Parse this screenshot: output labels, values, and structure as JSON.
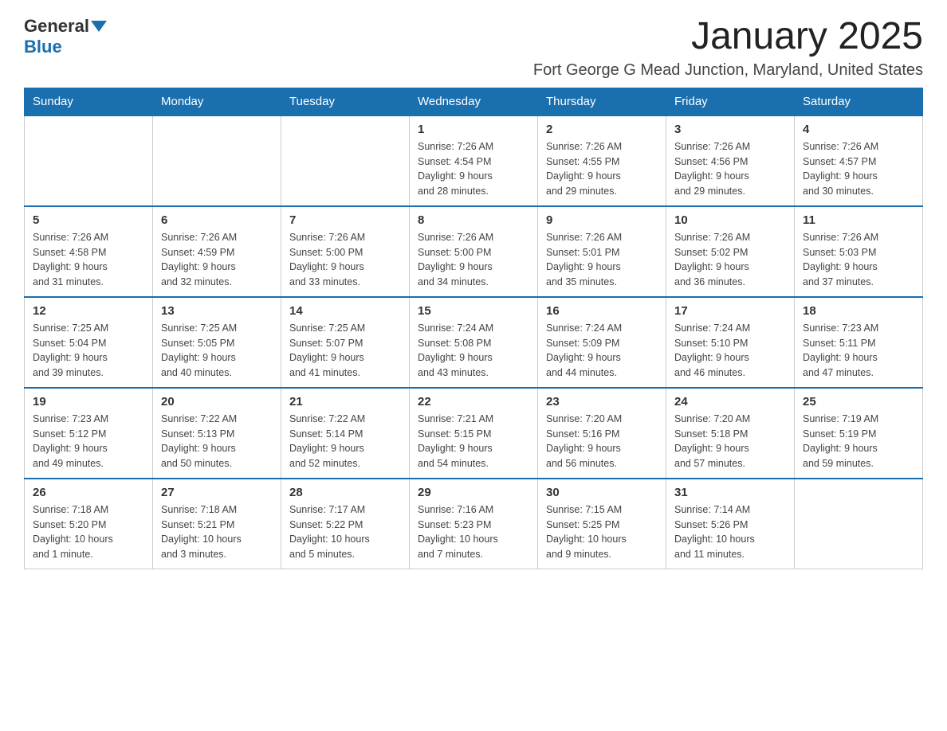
{
  "header": {
    "logo_general": "General",
    "logo_blue": "Blue",
    "month": "January 2025",
    "location": "Fort George G Mead Junction, Maryland, United States"
  },
  "days_of_week": [
    "Sunday",
    "Monday",
    "Tuesday",
    "Wednesday",
    "Thursday",
    "Friday",
    "Saturday"
  ],
  "weeks": [
    {
      "days": [
        {
          "date": "",
          "info": ""
        },
        {
          "date": "",
          "info": ""
        },
        {
          "date": "",
          "info": ""
        },
        {
          "date": "1",
          "info": "Sunrise: 7:26 AM\nSunset: 4:54 PM\nDaylight: 9 hours\nand 28 minutes."
        },
        {
          "date": "2",
          "info": "Sunrise: 7:26 AM\nSunset: 4:55 PM\nDaylight: 9 hours\nand 29 minutes."
        },
        {
          "date": "3",
          "info": "Sunrise: 7:26 AM\nSunset: 4:56 PM\nDaylight: 9 hours\nand 29 minutes."
        },
        {
          "date": "4",
          "info": "Sunrise: 7:26 AM\nSunset: 4:57 PM\nDaylight: 9 hours\nand 30 minutes."
        }
      ]
    },
    {
      "days": [
        {
          "date": "5",
          "info": "Sunrise: 7:26 AM\nSunset: 4:58 PM\nDaylight: 9 hours\nand 31 minutes."
        },
        {
          "date": "6",
          "info": "Sunrise: 7:26 AM\nSunset: 4:59 PM\nDaylight: 9 hours\nand 32 minutes."
        },
        {
          "date": "7",
          "info": "Sunrise: 7:26 AM\nSunset: 5:00 PM\nDaylight: 9 hours\nand 33 minutes."
        },
        {
          "date": "8",
          "info": "Sunrise: 7:26 AM\nSunset: 5:00 PM\nDaylight: 9 hours\nand 34 minutes."
        },
        {
          "date": "9",
          "info": "Sunrise: 7:26 AM\nSunset: 5:01 PM\nDaylight: 9 hours\nand 35 minutes."
        },
        {
          "date": "10",
          "info": "Sunrise: 7:26 AM\nSunset: 5:02 PM\nDaylight: 9 hours\nand 36 minutes."
        },
        {
          "date": "11",
          "info": "Sunrise: 7:26 AM\nSunset: 5:03 PM\nDaylight: 9 hours\nand 37 minutes."
        }
      ]
    },
    {
      "days": [
        {
          "date": "12",
          "info": "Sunrise: 7:25 AM\nSunset: 5:04 PM\nDaylight: 9 hours\nand 39 minutes."
        },
        {
          "date": "13",
          "info": "Sunrise: 7:25 AM\nSunset: 5:05 PM\nDaylight: 9 hours\nand 40 minutes."
        },
        {
          "date": "14",
          "info": "Sunrise: 7:25 AM\nSunset: 5:07 PM\nDaylight: 9 hours\nand 41 minutes."
        },
        {
          "date": "15",
          "info": "Sunrise: 7:24 AM\nSunset: 5:08 PM\nDaylight: 9 hours\nand 43 minutes."
        },
        {
          "date": "16",
          "info": "Sunrise: 7:24 AM\nSunset: 5:09 PM\nDaylight: 9 hours\nand 44 minutes."
        },
        {
          "date": "17",
          "info": "Sunrise: 7:24 AM\nSunset: 5:10 PM\nDaylight: 9 hours\nand 46 minutes."
        },
        {
          "date": "18",
          "info": "Sunrise: 7:23 AM\nSunset: 5:11 PM\nDaylight: 9 hours\nand 47 minutes."
        }
      ]
    },
    {
      "days": [
        {
          "date": "19",
          "info": "Sunrise: 7:23 AM\nSunset: 5:12 PM\nDaylight: 9 hours\nand 49 minutes."
        },
        {
          "date": "20",
          "info": "Sunrise: 7:22 AM\nSunset: 5:13 PM\nDaylight: 9 hours\nand 50 minutes."
        },
        {
          "date": "21",
          "info": "Sunrise: 7:22 AM\nSunset: 5:14 PM\nDaylight: 9 hours\nand 52 minutes."
        },
        {
          "date": "22",
          "info": "Sunrise: 7:21 AM\nSunset: 5:15 PM\nDaylight: 9 hours\nand 54 minutes."
        },
        {
          "date": "23",
          "info": "Sunrise: 7:20 AM\nSunset: 5:16 PM\nDaylight: 9 hours\nand 56 minutes."
        },
        {
          "date": "24",
          "info": "Sunrise: 7:20 AM\nSunset: 5:18 PM\nDaylight: 9 hours\nand 57 minutes."
        },
        {
          "date": "25",
          "info": "Sunrise: 7:19 AM\nSunset: 5:19 PM\nDaylight: 9 hours\nand 59 minutes."
        }
      ]
    },
    {
      "days": [
        {
          "date": "26",
          "info": "Sunrise: 7:18 AM\nSunset: 5:20 PM\nDaylight: 10 hours\nand 1 minute."
        },
        {
          "date": "27",
          "info": "Sunrise: 7:18 AM\nSunset: 5:21 PM\nDaylight: 10 hours\nand 3 minutes."
        },
        {
          "date": "28",
          "info": "Sunrise: 7:17 AM\nSunset: 5:22 PM\nDaylight: 10 hours\nand 5 minutes."
        },
        {
          "date": "29",
          "info": "Sunrise: 7:16 AM\nSunset: 5:23 PM\nDaylight: 10 hours\nand 7 minutes."
        },
        {
          "date": "30",
          "info": "Sunrise: 7:15 AM\nSunset: 5:25 PM\nDaylight: 10 hours\nand 9 minutes."
        },
        {
          "date": "31",
          "info": "Sunrise: 7:14 AM\nSunset: 5:26 PM\nDaylight: 10 hours\nand 11 minutes."
        },
        {
          "date": "",
          "info": ""
        }
      ]
    }
  ]
}
